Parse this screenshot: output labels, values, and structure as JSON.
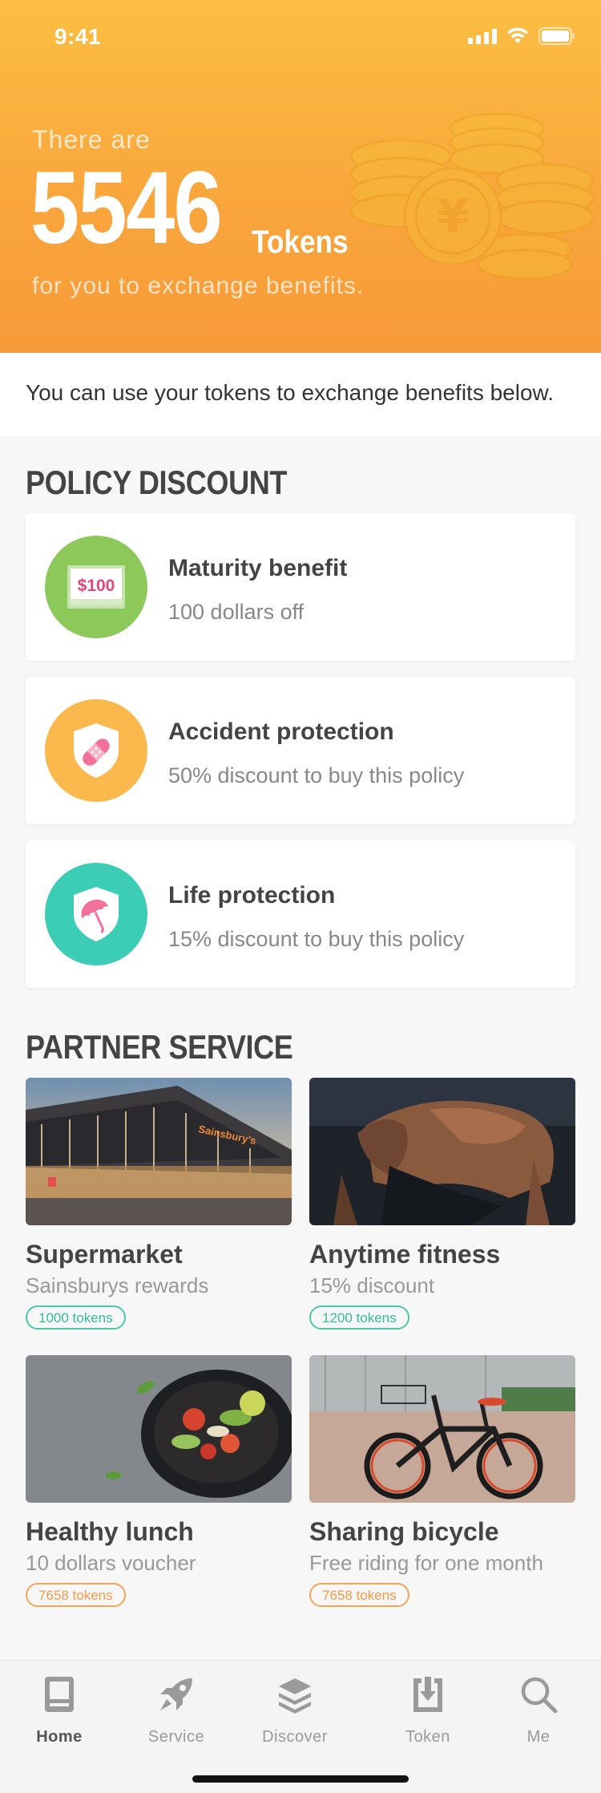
{
  "status": {
    "time": "9:41"
  },
  "hero": {
    "pre_text": "There are",
    "token_count": "5546",
    "token_unit": "Tokens",
    "post_text": "for you to exchange benefits."
  },
  "intro_text": "You can use your tokens to exchange benefits below.",
  "policy_section": {
    "title": "POLICY DISCOUNT",
    "cards": [
      {
        "title": "Maturity benefit",
        "subtitle": "100 dollars off",
        "icon": "money-note-icon",
        "icon_text": "$100",
        "color": "#8cc85a"
      },
      {
        "title": "Accident protection",
        "subtitle": "50% discount to buy this policy",
        "icon": "shield-bandage-icon",
        "color": "#fbb84c"
      },
      {
        "title": "Life protection",
        "subtitle": "15% discount to buy this policy",
        "icon": "shield-umbrella-icon",
        "color": "#3ccdb6"
      }
    ]
  },
  "partner_section": {
    "title": "PARTNER SERVICE",
    "items": [
      {
        "title": "Supermarket",
        "subtitle": "Sainsburys rewards",
        "badge": "1000 tokens",
        "badge_color": "green",
        "image": "supermarket-photo",
        "image_sign": "Sainsbury's"
      },
      {
        "title": "Anytime fitness",
        "subtitle": "15% discount",
        "badge": "1200 tokens",
        "badge_color": "green",
        "image": "fitness-photo"
      },
      {
        "title": "Healthy lunch",
        "subtitle": "10 dollars voucher",
        "badge": "7658 tokens",
        "badge_color": "orange",
        "image": "salad-photo"
      },
      {
        "title": "Sharing bicycle",
        "subtitle": "Free riding for one month",
        "badge": "7658 tokens",
        "badge_color": "orange",
        "image": "bicycle-photo"
      }
    ]
  },
  "tabbar": {
    "tabs": [
      {
        "label": "Home",
        "icon": "home-icon",
        "active": true
      },
      {
        "label": "Service",
        "icon": "rocket-icon",
        "active": false
      },
      {
        "label": "Discover",
        "icon": "layers-icon",
        "active": false
      },
      {
        "label": "Token",
        "icon": "download-icon",
        "active": false
      },
      {
        "label": "Me",
        "icon": "search-icon",
        "active": false
      }
    ]
  },
  "colors": {
    "hero_top": "#fbbf43",
    "hero_bottom": "#f79a39",
    "badge_green": "#32bd9a",
    "badge_orange": "#f59a45"
  }
}
